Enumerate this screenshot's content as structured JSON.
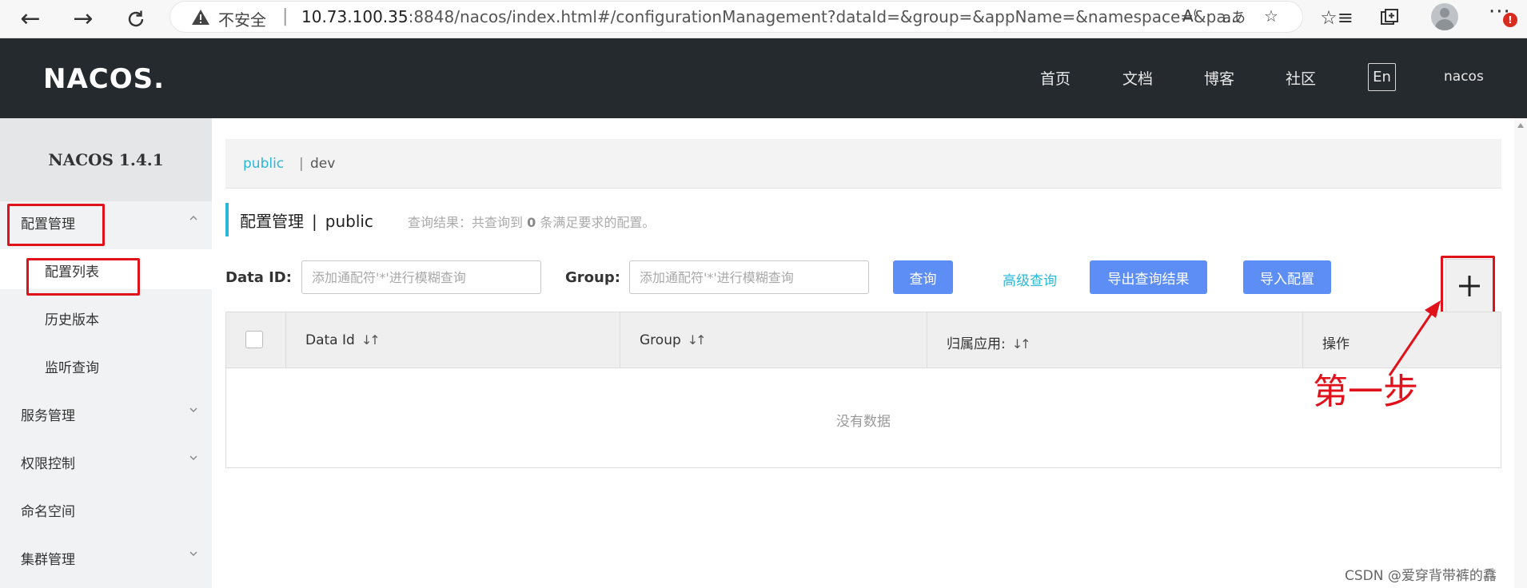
{
  "browser": {
    "insecure_label": "不安全",
    "url_host": "10.73.100.35",
    "url_rest": ":8848/nacos/index.html#/configurationManagement?dataId=&group=&appName=&namespace=&pa..."
  },
  "header": {
    "logo": "NACOS.",
    "nav": [
      "首页",
      "文档",
      "博客",
      "社区"
    ],
    "lang": "En",
    "user": "nacos"
  },
  "sidebar": {
    "version": "NACOS 1.4.1",
    "items": [
      {
        "label": "配置管理"
      },
      {
        "label": "配置列表"
      },
      {
        "label": "历史版本"
      },
      {
        "label": "监听查询"
      },
      {
        "label": "服务管理"
      },
      {
        "label": "权限控制"
      },
      {
        "label": "命名空间"
      },
      {
        "label": "集群管理"
      }
    ]
  },
  "namespace_bar": {
    "active": "public",
    "separator": "|",
    "other": "dev"
  },
  "page": {
    "title": "配置管理",
    "separator": "|",
    "namespace": "public",
    "result_prefix": "查询结果：共查询到 ",
    "result_count": "0",
    "result_suffix": " 条满足要求的配置。"
  },
  "search": {
    "dataid_label": "Data ID:",
    "dataid_placeholder": "添加通配符'*'进行模糊查询",
    "group_label": "Group:",
    "group_placeholder": "添加通配符'*'进行模糊查询",
    "query_button": "查询",
    "advanced_link": "高级查询",
    "export_button": "导出查询结果",
    "import_button": "导入配置",
    "add_button": "+"
  },
  "table": {
    "columns": [
      "Data Id",
      "Group",
      "归属应用:",
      "操作"
    ],
    "empty_text": "没有数据"
  },
  "annotation": {
    "text": "第一步"
  },
  "watermark": "CSDN @爱穿背带裤的馫",
  "colors": {
    "header_bg": "#252a2f",
    "accent": "#2ab8d8",
    "button": "#5c8ef6",
    "highlight": "#e0111a"
  }
}
